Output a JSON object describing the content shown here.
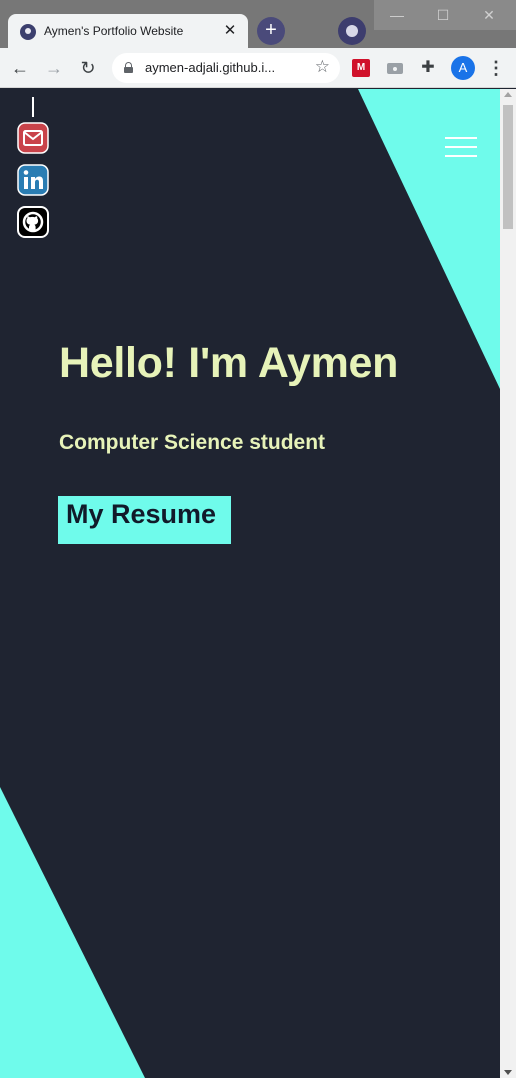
{
  "browser": {
    "tab_title": "Aymen's Portfolio Website",
    "tab_close": "✕",
    "new_tab": "+",
    "url": "aymen-adjali.github.i...",
    "avatar_letter": "A",
    "window_controls": {
      "minimize": "—",
      "maximize": "☐",
      "close": "✕"
    },
    "extension_red_label": "M"
  },
  "page": {
    "hero_title": "Hello! I'm Aymen",
    "hero_subtitle": "Computer Science student",
    "resume_button": "My Resume",
    "social_icons": [
      "email-icon",
      "linkedin-icon",
      "github-icon"
    ]
  },
  "colors": {
    "background": "#1f2431",
    "accent": "#6ffbeb",
    "hero_text": "#e7f3b9",
    "button_text": "#111a2a"
  }
}
